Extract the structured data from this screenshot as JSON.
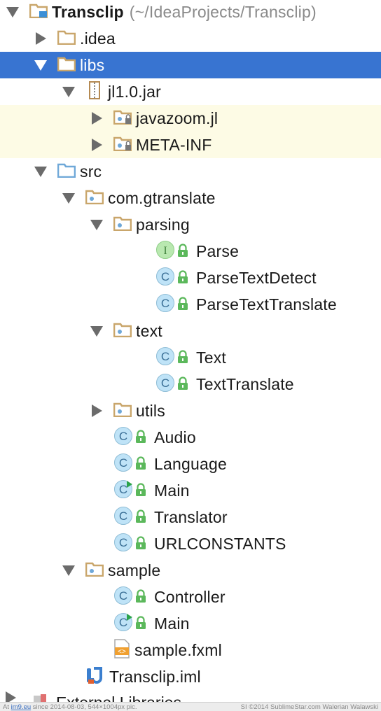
{
  "project": {
    "name": "Transclip",
    "path": "(~/IdeaProjects/Transclip)"
  },
  "tree": [
    {
      "label": "Transclip",
      "suffix": "(~/IdeaProjects/Transclip)",
      "depth": 0,
      "expanded": true,
      "icon": "project-folder-icon",
      "bold": true
    },
    {
      "label": ".idea",
      "depth": 1,
      "expanded": false,
      "icon": "folder-icon"
    },
    {
      "label": "libs",
      "depth": 1,
      "expanded": true,
      "icon": "folder-icon",
      "selected": true
    },
    {
      "label": "jl1.0.jar",
      "depth": 2,
      "expanded": true,
      "icon": "jar-icon"
    },
    {
      "label": "javazoom.jl",
      "depth": 3,
      "expanded": false,
      "icon": "package-locked-icon",
      "highlight": true
    },
    {
      "label": "META-INF",
      "depth": 3,
      "expanded": false,
      "icon": "package-locked-icon",
      "highlight": true
    },
    {
      "label": "src",
      "depth": 1,
      "expanded": true,
      "icon": "source-folder-icon"
    },
    {
      "label": "com.gtranslate",
      "depth": 2,
      "expanded": true,
      "icon": "package-icon"
    },
    {
      "label": "parsing",
      "depth": 3,
      "expanded": true,
      "icon": "package-icon"
    },
    {
      "label": "Parse",
      "depth": 4,
      "icon": "interface-icon",
      "lock": true
    },
    {
      "label": "ParseTextDetect",
      "depth": 4,
      "icon": "class-icon",
      "lock": true
    },
    {
      "label": "ParseTextTranslate",
      "depth": 4,
      "icon": "class-icon",
      "lock": true
    },
    {
      "label": "text",
      "depth": 3,
      "expanded": true,
      "icon": "package-icon"
    },
    {
      "label": "Text",
      "depth": 4,
      "icon": "class-icon",
      "lock": true
    },
    {
      "label": "TextTranslate",
      "depth": 4,
      "icon": "class-icon",
      "lock": true
    },
    {
      "label": "utils",
      "depth": 3,
      "expanded": false,
      "icon": "package-icon"
    },
    {
      "label": "Audio",
      "depth": 3,
      "icon": "class-icon",
      "lock": true,
      "leafInline": true
    },
    {
      "label": "Language",
      "depth": 3,
      "icon": "class-icon",
      "lock": true,
      "leafInline": true
    },
    {
      "label": "Main",
      "depth": 3,
      "icon": "runnable-class-icon",
      "lock": true,
      "leafInline": true
    },
    {
      "label": "Translator",
      "depth": 3,
      "icon": "class-icon",
      "lock": true,
      "leafInline": true
    },
    {
      "label": "URLCONSTANTS",
      "depth": 3,
      "icon": "class-icon",
      "lock": true,
      "leafInline": true
    },
    {
      "label": "sample",
      "depth": 2,
      "expanded": true,
      "icon": "package-icon"
    },
    {
      "label": "Controller",
      "depth": 3,
      "icon": "class-icon",
      "lock": true,
      "leafInline": true
    },
    {
      "label": "Main",
      "depth": 3,
      "icon": "runnable-class-icon",
      "lock": true,
      "leafInline": true
    },
    {
      "label": "sample.fxml",
      "depth": 3,
      "icon": "fxml-file-icon",
      "leafInline": true
    },
    {
      "label": "Transclip.iml",
      "depth": 2,
      "icon": "iml-file-icon",
      "leafInline": true
    }
  ],
  "partial_row": {
    "label": "External Libraries"
  },
  "footer": {
    "left_prefix": "At ",
    "left_link": "im9.eu",
    "left_suffix": " since 2014-08-03, 544×1004px pic.",
    "right": "SI ©2014 SublimeStar.com Walerian Walawski"
  },
  "colors": {
    "selection": "#3874d1",
    "highlight": "#fdfbe5",
    "folder": "#c9a66b",
    "class_circle": "#bfe3f7",
    "interface_circle": "#b9e8b0",
    "lock": "#5bb85b"
  }
}
